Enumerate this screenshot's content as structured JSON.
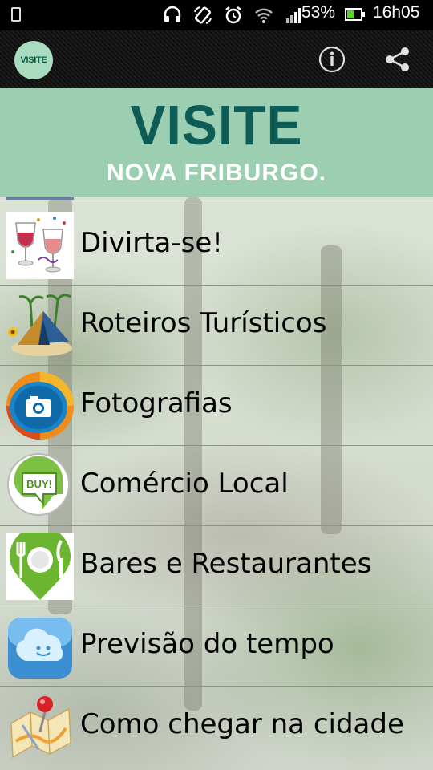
{
  "status_bar": {
    "battery_percent": "53%",
    "time": "16h05",
    "battery_level": 0.53,
    "icons": [
      "phone-icon",
      "headset-icon",
      "rotate-icon",
      "alarm-icon",
      "wifi-icon",
      "signal-icon"
    ]
  },
  "action_bar": {
    "logo_text": "VISITE",
    "icons": [
      "info-icon",
      "share-icon"
    ]
  },
  "banner": {
    "title": "VISITE",
    "subtitle": "NOVA FRIBURGO.",
    "title_color": "#0d5c55",
    "background_color": "#9ccfb2"
  },
  "menu": {
    "items": [
      {
        "label": "Divirta-se!",
        "icon": "party-glasses-icon"
      },
      {
        "label": "Roteiros Turísticos",
        "icon": "tent-icon"
      },
      {
        "label": "Fotografias",
        "icon": "camera-icon"
      },
      {
        "label": "Comércio Local",
        "icon": "buy-tag-icon"
      },
      {
        "label": "Bares e Restaurantes",
        "icon": "restaurant-pin-icon"
      },
      {
        "label": "Previsão do tempo",
        "icon": "weather-cloud-icon"
      },
      {
        "label": "Como chegar na cidade",
        "icon": "map-pin-icon"
      }
    ]
  }
}
